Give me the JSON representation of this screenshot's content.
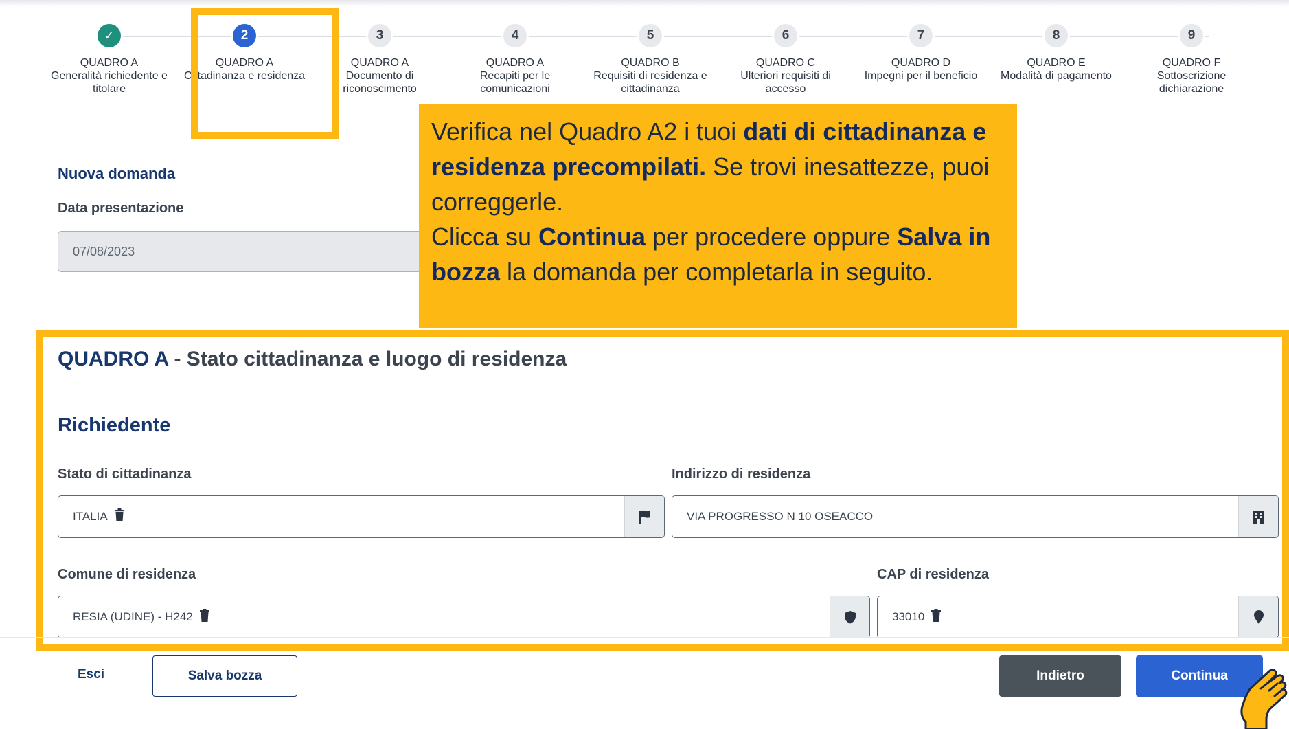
{
  "stepper": {
    "steps": [
      {
        "number": "✓",
        "title": "QUADRO A",
        "subtitle": "Generalità richiedente e titolare",
        "state": "done"
      },
      {
        "number": "2",
        "title": "QUADRO A",
        "subtitle": "Cittadinanza e residenza",
        "state": "active"
      },
      {
        "number": "3",
        "title": "QUADRO A",
        "subtitle": "Documento di riconoscimento",
        "state": "todo"
      },
      {
        "number": "4",
        "title": "QUADRO A",
        "subtitle": "Recapiti per le comunicazioni",
        "state": "todo"
      },
      {
        "number": "5",
        "title": "QUADRO B",
        "subtitle": "Requisiti di residenza e cittadinanza",
        "state": "todo"
      },
      {
        "number": "6",
        "title": "QUADRO C",
        "subtitle": "Ulteriori requisiti di accesso",
        "state": "todo"
      },
      {
        "number": "7",
        "title": "QUADRO D",
        "subtitle": "Impegni per il beneficio",
        "state": "todo"
      },
      {
        "number": "8",
        "title": "QUADRO E",
        "subtitle": "Modalità di pagamento",
        "state": "todo"
      },
      {
        "number": "9",
        "title": "QUADRO F",
        "subtitle": "Sottoscrizione dichiarazione",
        "state": "todo"
      }
    ]
  },
  "tooltip": {
    "part1": "Verifica nel Quadro A2 i tuoi ",
    "bold1": "dati di cittadinanza e residenza precompilati.",
    "part2": " Se trovi inesattezze, puoi correggerle.",
    "part3": "Clicca su ",
    "bold2": "Continua",
    "part4": " per procedere oppure ",
    "bold3": "Salva in bozza",
    "part5": " la domanda per completarla in seguito."
  },
  "form": {
    "heading": "Nuova domanda",
    "date_label": "Data presentazione",
    "date_value": "07/08/2023"
  },
  "section": {
    "title_prefix": "QUADRO A",
    "title_rest": " - Stato cittadinanza e luogo di residenza",
    "subtitle": "Richiedente",
    "fields": {
      "cittadinanza_label": "Stato di cittadinanza",
      "cittadinanza_value": "ITALIA",
      "indirizzo_label": "Indirizzo di residenza",
      "indirizzo_value": "VIA PROGRESSO N 10 OSEACCO",
      "comune_label": "Comune di residenza",
      "comune_value": "RESIA (UDINE) - H242",
      "cap_label": "CAP di residenza",
      "cap_value": "33010"
    }
  },
  "footer": {
    "esci": "Esci",
    "salva_bozza": "Salva bozza",
    "indietro": "Indietro",
    "continua": "Continua"
  },
  "colors": {
    "highlight": "#fdb813",
    "primary": "#2c63d3",
    "done": "#1f8f7e",
    "navy": "#17376e"
  }
}
